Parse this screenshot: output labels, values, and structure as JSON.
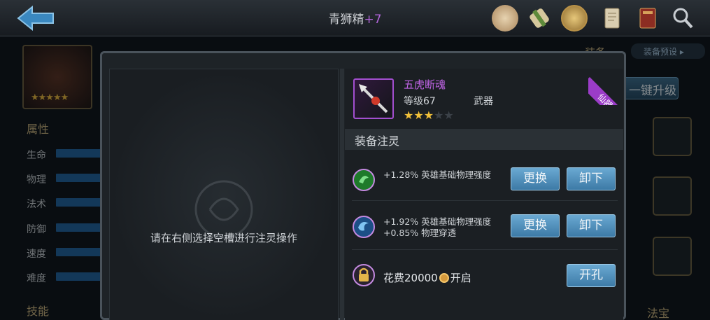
{
  "header": {
    "title": "青狮精",
    "title_suffix": "+7",
    "icons": [
      "scroll-seal-icon",
      "rolled-scroll-icon",
      "coin-icon",
      "document-icon",
      "book-icon",
      "magnifier-icon"
    ]
  },
  "hero": {
    "stars": "★★★★★"
  },
  "attributes": {
    "title": "属性",
    "stats": [
      {
        "label": "生命"
      },
      {
        "label": "物理"
      },
      {
        "label": "法术"
      },
      {
        "label": "防御"
      },
      {
        "label": "速度"
      },
      {
        "label": "难度"
      }
    ]
  },
  "skills_title": "技能",
  "equipment": {
    "title": "装备",
    "preset_label": "装备预设",
    "upgrade_label": "一键升级",
    "treasure_label": "法宝"
  },
  "modal": {
    "hint": "请在右侧选择空槽进行注灵操作",
    "item": {
      "name": "五虎断魂",
      "level": "等级67",
      "type": "武器",
      "stars_filled": 3,
      "stars_total": 5,
      "quality": "仙器"
    },
    "section_title": "装备注灵",
    "slots": [
      {
        "orb": "green-spirit-orb-icon",
        "effect_1": "+1.28% 英雄基础物理强度",
        "effect_2": "",
        "replace_label": "更换",
        "remove_label": "卸下"
      },
      {
        "orb": "blue-spirit-orb-icon",
        "effect_1": "+1.92% 英雄基础物理强度",
        "effect_2": "+0.85% 物理穿透",
        "replace_label": "更换",
        "remove_label": "卸下"
      }
    ],
    "locked_slot": {
      "cost_prefix": "花费20000",
      "cost_suffix": "开启",
      "open_label": "开孔"
    }
  },
  "colors": {
    "accent_purple": "#c466ea",
    "button_blue": "#3d7aa6",
    "star_gold": "#f0c03a"
  }
}
